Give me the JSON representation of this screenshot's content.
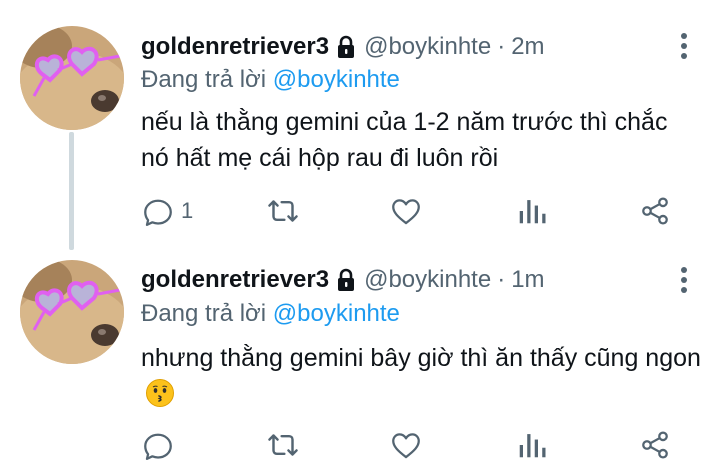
{
  "tweets": [
    {
      "display_name": "goldenretriever3",
      "handle": "@boykinhte",
      "separator": "·",
      "time": "2m",
      "reply_prefix": "Đang trả lời",
      "reply_mention": "@boykinhte",
      "text": "nếu là thằng gemini của 1-2 năm trước thì chắc nó hất mẹ cái hộp rau đi luôn rồi",
      "reply_count": "1",
      "icons": [
        "lock-icon",
        "more-vertical-icon",
        "reply-icon",
        "retweet-icon",
        "like-icon",
        "views-icon",
        "share-icon"
      ]
    },
    {
      "display_name": "goldenretriever3",
      "handle": "@boykinhte",
      "separator": "·",
      "time": "1m",
      "reply_prefix": "Đang trả lời",
      "reply_mention": "@boykinhte",
      "text": "nhưng thằng gemini bây giờ thì ăn thấy cũng ngon",
      "text_emoji": "kissing-face-emoji",
      "reply_count": "",
      "icons": [
        "lock-icon",
        "more-vertical-icon",
        "reply-icon",
        "retweet-icon",
        "like-icon",
        "views-icon",
        "share-icon"
      ]
    }
  ],
  "colors": {
    "primary_text": "#0f1419",
    "secondary_text": "#536471",
    "mention": "#1d9bf0",
    "thread_line": "#cfd9de",
    "sunglasses": "#e060f0"
  }
}
